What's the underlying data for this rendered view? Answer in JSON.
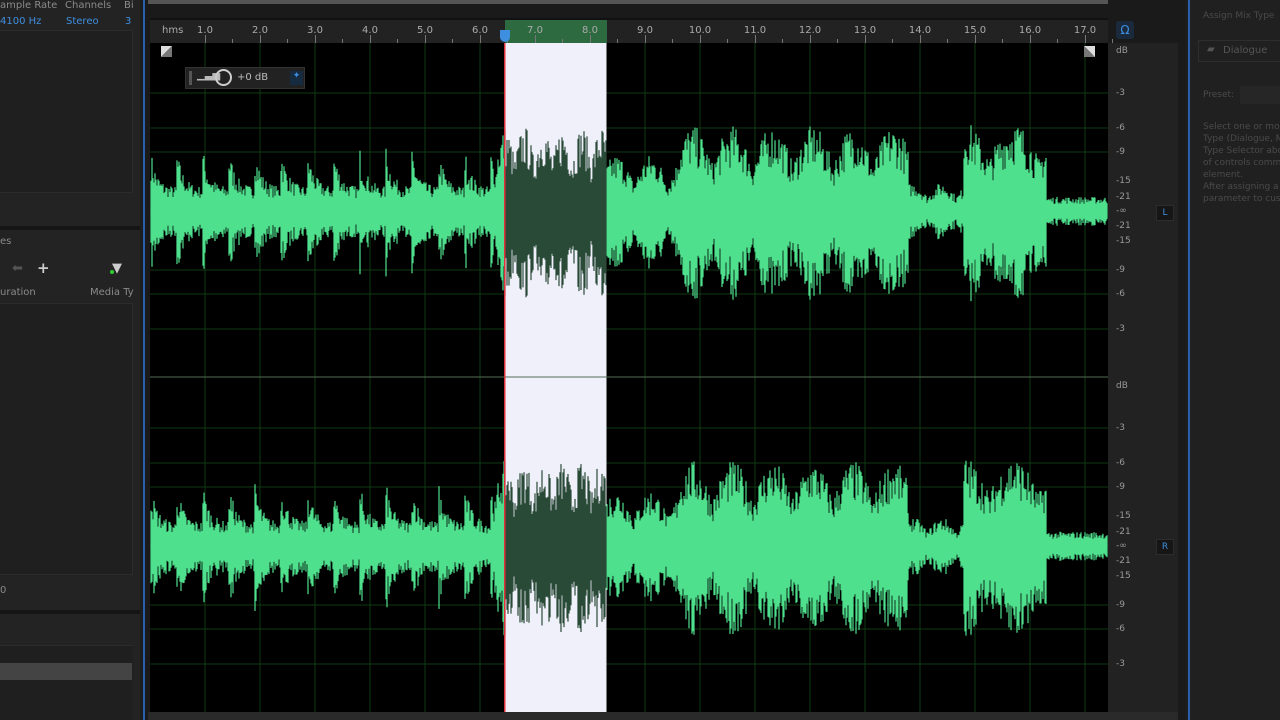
{
  "files_panel": {
    "columns": [
      "ample Rate",
      "Channels",
      "Bi"
    ],
    "row": {
      "sample_rate": "4100 Hz",
      "channels": "Stereo",
      "bit": "3"
    },
    "markers_title": "es",
    "columns2": [
      "uration",
      "Media Ty"
    ],
    "bottom_value": "0"
  },
  "ruler": {
    "unit": "hms",
    "labels": [
      "1.0",
      "2.0",
      "3.0",
      "4.0",
      "5.0",
      "6.0",
      "7.0",
      "8.0",
      "9.0",
      "10.0",
      "11.0",
      "12.0",
      "13.0",
      "14.0",
      "15.0",
      "16.0",
      "17.0"
    ]
  },
  "selection": {
    "start_s": 6.45,
    "end_s": 8.3
  },
  "gain_hud": {
    "value": "+0 dB"
  },
  "db_scale": {
    "title": "dB",
    "labels": [
      "-3",
      "-6",
      "-9",
      "-15",
      "-21",
      "-∞",
      "-21",
      "-15",
      "-9",
      "-6",
      "-3"
    ]
  },
  "channels": [
    {
      "label": "L"
    },
    {
      "label": "R"
    }
  ],
  "colors": {
    "waveform": "#4fe08e",
    "waveform_selected": "#2a4a38",
    "selection": "#f0f0fa",
    "playhead": "#e0303a",
    "accent": "#3f8fe0"
  },
  "right_panel": {
    "title": "Assign Mix Type",
    "dialogue_button": "Dialogue",
    "preset_label": "Preset:",
    "help_lines": [
      "Select one or mo",
      "Type (Dialogue, M",
      "Type Selector abo",
      "of controls comm",
      "element.",
      "After assigning a",
      "parameter to cus"
    ]
  }
}
